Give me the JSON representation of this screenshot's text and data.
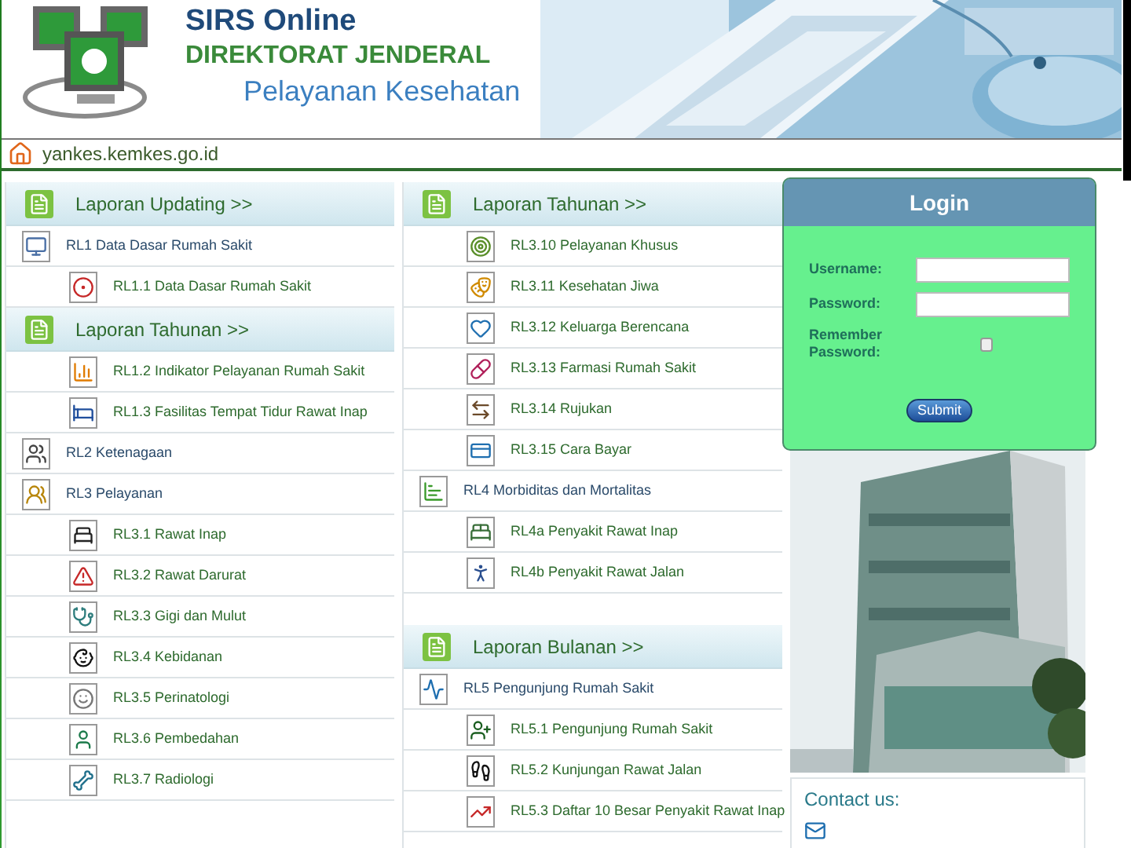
{
  "header": {
    "title": "SIRS Online",
    "subtitle": "DIREKTORAT JENDERAL",
    "department": "Pelayanan Kesehatan"
  },
  "address": {
    "text": "yankes.kemkes.go.id"
  },
  "columns": [
    {
      "rows": [
        {
          "kind": "header",
          "label": "Laporan Updating >>"
        },
        {
          "kind": "item",
          "label": "RL1 Data Dasar Rumah Sakit"
        },
        {
          "kind": "sub",
          "label": "RL1.1 Data Dasar Rumah Sakit"
        },
        {
          "kind": "header",
          "label": "Laporan Tahunan >>"
        },
        {
          "kind": "sub",
          "label": "RL1.2 Indikator Pelayanan Rumah Sakit"
        },
        {
          "kind": "sub",
          "label": "RL1.3 Fasilitas Tempat Tidur Rawat Inap"
        },
        {
          "kind": "item",
          "label": "RL2 Ketenagaan"
        },
        {
          "kind": "item",
          "label": "RL3 Pelayanan"
        },
        {
          "kind": "sub",
          "label": "RL3.1 Rawat Inap"
        },
        {
          "kind": "sub",
          "label": "RL3.2 Rawat Darurat"
        },
        {
          "kind": "sub",
          "label": "RL3.3 Gigi dan Mulut"
        },
        {
          "kind": "sub",
          "label": "RL3.4 Kebidanan"
        },
        {
          "kind": "sub",
          "label": "RL3.5 Perinatologi"
        },
        {
          "kind": "sub",
          "label": "RL3.6 Pembedahan"
        },
        {
          "kind": "sub",
          "label": "RL3.7 Radiologi"
        }
      ]
    },
    {
      "rows": [
        {
          "kind": "header",
          "label": "Laporan Tahunan >>"
        },
        {
          "kind": "sub",
          "label": "RL3.10 Pelayanan Khusus"
        },
        {
          "kind": "sub",
          "label": "RL3.11 Kesehatan Jiwa"
        },
        {
          "kind": "sub",
          "label": "RL3.12 Keluarga Berencana"
        },
        {
          "kind": "sub",
          "label": "RL3.13 Farmasi Rumah Sakit"
        },
        {
          "kind": "sub",
          "label": "RL3.14 Rujukan"
        },
        {
          "kind": "sub",
          "label": "RL3.15 Cara Bayar"
        },
        {
          "kind": "item",
          "label": "RL4 Morbiditas dan Mortalitas"
        },
        {
          "kind": "sub",
          "label": "RL4a Penyakit Rawat Inap"
        },
        {
          "kind": "sub",
          "label": "RL4b Penyakit Rawat Jalan"
        },
        {
          "kind": "header",
          "label": "Laporan Bulanan >>"
        },
        {
          "kind": "item",
          "label": "RL5 Pengunjung Rumah Sakit"
        },
        {
          "kind": "sub",
          "label": "RL5.1 Pengunjung Rumah Sakit"
        },
        {
          "kind": "sub",
          "label": "RL5.2 Kunjungan Rawat Jalan"
        },
        {
          "kind": "sub",
          "label": "RL5.3 Daftar 10 Besar Penyakit Rawat Inap"
        }
      ]
    }
  ],
  "login": {
    "title": "Login",
    "username": {
      "label": "Username:"
    },
    "password": {
      "label": "Password:"
    },
    "remember": {
      "label": "Remember Password:",
      "checked": false
    },
    "submit": "Submit"
  },
  "contact": {
    "title": "Contact us:"
  }
}
